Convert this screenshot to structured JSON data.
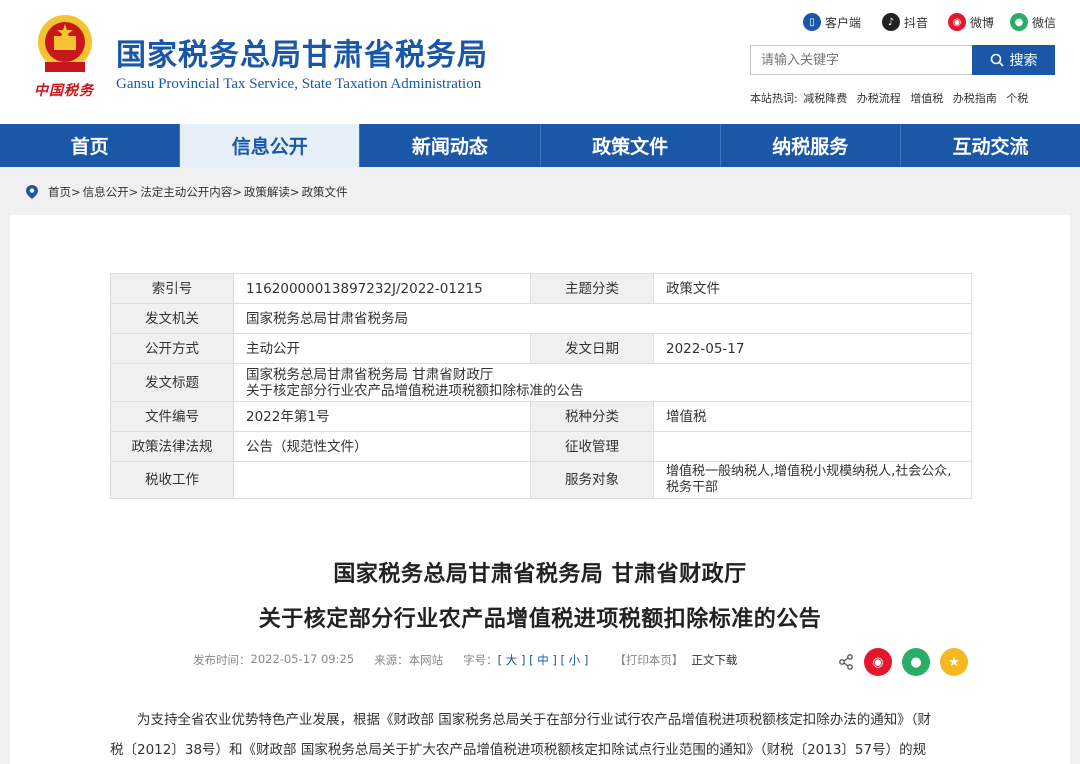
{
  "header": {
    "title": "国家税务总局甘肃省税务局",
    "subtitle": "Gansu Provincial Tax Service, State Taxation Administration",
    "logo_text": "中国税务",
    "social": [
      {
        "label": "客户端",
        "icon": "mobile-icon",
        "color": "#1a57a6"
      },
      {
        "label": "抖音",
        "icon": "douyin-icon",
        "color": "#222222"
      },
      {
        "label": "微博",
        "icon": "weibo-icon",
        "color": "#e6162d"
      },
      {
        "label": "微信",
        "icon": "wechat-icon",
        "color": "#2aae67"
      }
    ],
    "search": {
      "placeholder": "请输入关键字",
      "button": "搜索"
    },
    "hot_label": "本站热词:",
    "hot_words": [
      "减税降费",
      "办税流程",
      "增值税",
      "办税指南",
      "个税"
    ]
  },
  "nav": {
    "items": [
      "首页",
      "信息公开",
      "新闻动态",
      "政策文件",
      "纳税服务",
      "互动交流"
    ],
    "active_index": 1
  },
  "breadcrumb": [
    "首页>",
    "信息公开>",
    "法定主动公开内容>",
    "政策解读>",
    "政策文件"
  ],
  "meta": {
    "index_no_label": "索引号",
    "index_no": "11620000013897232J/2022-01215",
    "topic_label": "主题分类",
    "topic": "政策文件",
    "issuer_label": "发文机关",
    "issuer": "国家税务总局甘肃省税务局",
    "disclosure_label": "公开方式",
    "disclosure": "主动公开",
    "date_label": "发文日期",
    "date": "2022-05-17",
    "doc_title_label": "发文标题",
    "doc_title_line1": "国家税务总局甘肃省税务局 甘肃省财政厅",
    "doc_title_line2": "关于核定部分行业农产品增值税进项税额扣除标准的公告",
    "doc_no_label": "文件编号",
    "doc_no": "2022年第1号",
    "tax_type_label": "税种分类",
    "tax_type": "增值税",
    "policy_label": "政策法律法规",
    "policy": "公告（规范性文件）",
    "collection_label": "征收管理",
    "collection": "",
    "tax_work_label": "税收工作",
    "tax_work": "",
    "service_label": "服务对象",
    "service_line1": "增值税一般纳税人,增值税小规模纳税人,社会公众,",
    "service_line2": "税务干部"
  },
  "article": {
    "title_line1": "国家税务总局甘肃省税务局 甘肃省财政厅",
    "title_line2": "关于核定部分行业农产品增值税进项税额扣除标准的公告",
    "publish_label": "发布时间：",
    "publish_time": "2022-05-17 09:25",
    "source_label": "来源：",
    "source": "本网站",
    "font_label": "字号：",
    "font_large": "大",
    "font_medium": "中",
    "font_small": "小",
    "print": "【打印本页】",
    "download": "正文下载",
    "body_line1": "为支持全省农业优势特色产业发展，根据《财政部 国家税务总局关于在部分行业试行农产品增值税进项税额核定扣除办法的通知》（财",
    "body_line2": "税〔2012〕38号）和《财政部 国家税务总局关于扩大农产品增值税进项税额核定扣除试点行业范围的通知》（财税〔2013〕57号）的规"
  },
  "share_icons": [
    {
      "name": "share-icon",
      "color": "#555555"
    },
    {
      "name": "weibo-share-icon",
      "color": "#e6162d"
    },
    {
      "name": "wechat-share-icon",
      "color": "#2aae67"
    },
    {
      "name": "favorite-icon",
      "color": "#f5b820"
    }
  ]
}
